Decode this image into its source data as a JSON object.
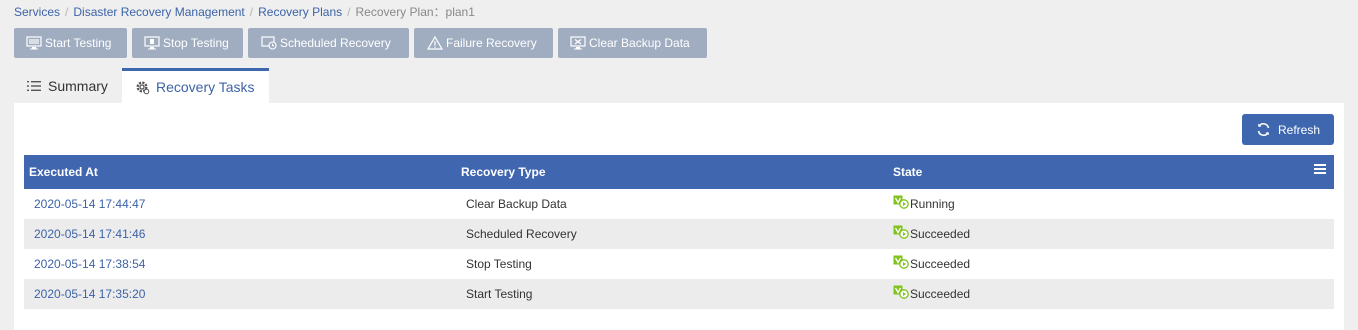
{
  "breadcrumb": {
    "items": [
      "Services",
      "Disaster Recovery Management",
      "Recovery Plans"
    ],
    "separator": "/",
    "current": "Recovery Plan：plan1"
  },
  "toolbar": {
    "buttons": [
      {
        "label": "Start Testing",
        "icon": "monitor-test-icon"
      },
      {
        "label": "Stop Testing",
        "icon": "monitor-stop-icon"
      },
      {
        "label": "Scheduled Recovery",
        "icon": "scheduled-recovery-icon"
      },
      {
        "label": "Failure Recovery",
        "icon": "warning-icon"
      },
      {
        "label": "Clear Backup Data",
        "icon": "clear-data-icon"
      }
    ]
  },
  "tabs": [
    {
      "label": "Summary",
      "icon": "list-icon",
      "active": false
    },
    {
      "label": "Recovery Tasks",
      "icon": "gear-icon",
      "active": true
    }
  ],
  "refresh_label": "Refresh",
  "table": {
    "columns": [
      "Executed At",
      "Recovery Type",
      "State"
    ],
    "rows": [
      {
        "executed_at": "2020-05-14 17:44:47",
        "type": "Clear Backup Data",
        "state": "Running"
      },
      {
        "executed_at": "2020-05-14 17:41:46",
        "type": "Scheduled Recovery",
        "state": "Succeeded"
      },
      {
        "executed_at": "2020-05-14 17:38:54",
        "type": "Stop Testing",
        "state": "Succeeded"
      },
      {
        "executed_at": "2020-05-14 17:35:20",
        "type": "Start Testing",
        "state": "Succeeded"
      }
    ]
  },
  "colors": {
    "header_blue": "#3f66af",
    "link_blue": "#3c63a8",
    "toolbar_button": "#a0adc1",
    "state_green": "#7fc31c"
  }
}
